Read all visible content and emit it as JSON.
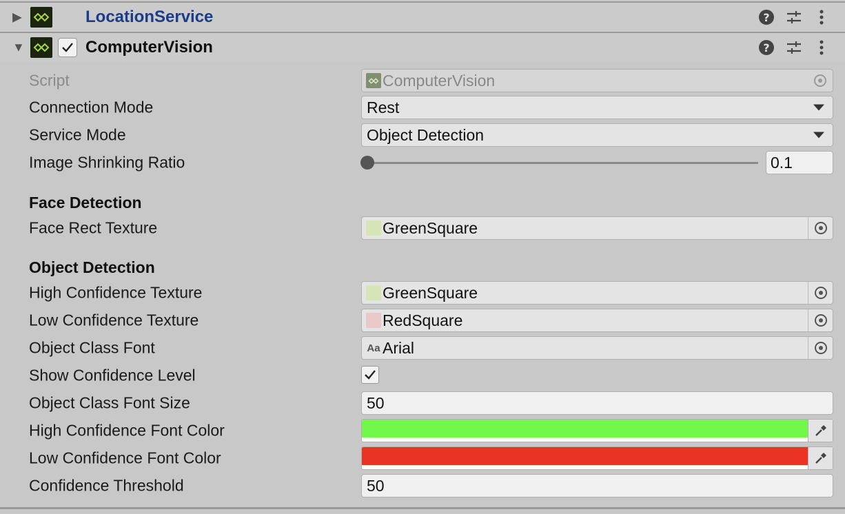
{
  "components": [
    {
      "title": "LocationService",
      "title_color": "#1a3c8a",
      "expanded": false
    },
    {
      "title": "ComputerVision",
      "title_color": "#101010",
      "expanded": true,
      "enabled": true
    }
  ],
  "header_icons": [
    "help-icon",
    "preset-sliders-icon",
    "kebab-menu-icon"
  ],
  "help_glyph": "?",
  "fields": {
    "script": {
      "label": "Script",
      "value": "ComputerVision"
    },
    "connection_mode": {
      "label": "Connection Mode",
      "value": "Rest"
    },
    "service_mode": {
      "label": "Service Mode",
      "value": "Object Detection"
    },
    "image_shrinking_ratio": {
      "label": "Image Shrinking Ratio",
      "value": "0.1",
      "slider_fraction": 0.0
    }
  },
  "face_detection": {
    "title": "Face Detection",
    "face_rect_texture": {
      "label": "Face Rect Texture",
      "value": "GreenSquare",
      "thumb_color": "#d6e4b8"
    }
  },
  "object_detection": {
    "title": "Object Detection",
    "high_confidence_texture": {
      "label": "High Confidence Texture",
      "value": "GreenSquare",
      "thumb_color": "#d6e4b8"
    },
    "low_confidence_texture": {
      "label": "Low Confidence Texture",
      "value": "RedSquare",
      "thumb_color": "#e8c8c8"
    },
    "object_class_font": {
      "label": "Object Class Font",
      "value": "Arial",
      "icon_text": "Aa"
    },
    "show_confidence_level": {
      "label": "Show Confidence Level",
      "checked": true
    },
    "object_class_font_size": {
      "label": "Object Class Font Size",
      "value": "50"
    },
    "high_confidence_font_color": {
      "label": "High Confidence Font Color",
      "color": "#72f84a"
    },
    "low_confidence_font_color": {
      "label": "Low Confidence Font Color",
      "color": "#eb3323"
    },
    "confidence_threshold": {
      "label": "Confidence Threshold",
      "value": "50"
    }
  }
}
